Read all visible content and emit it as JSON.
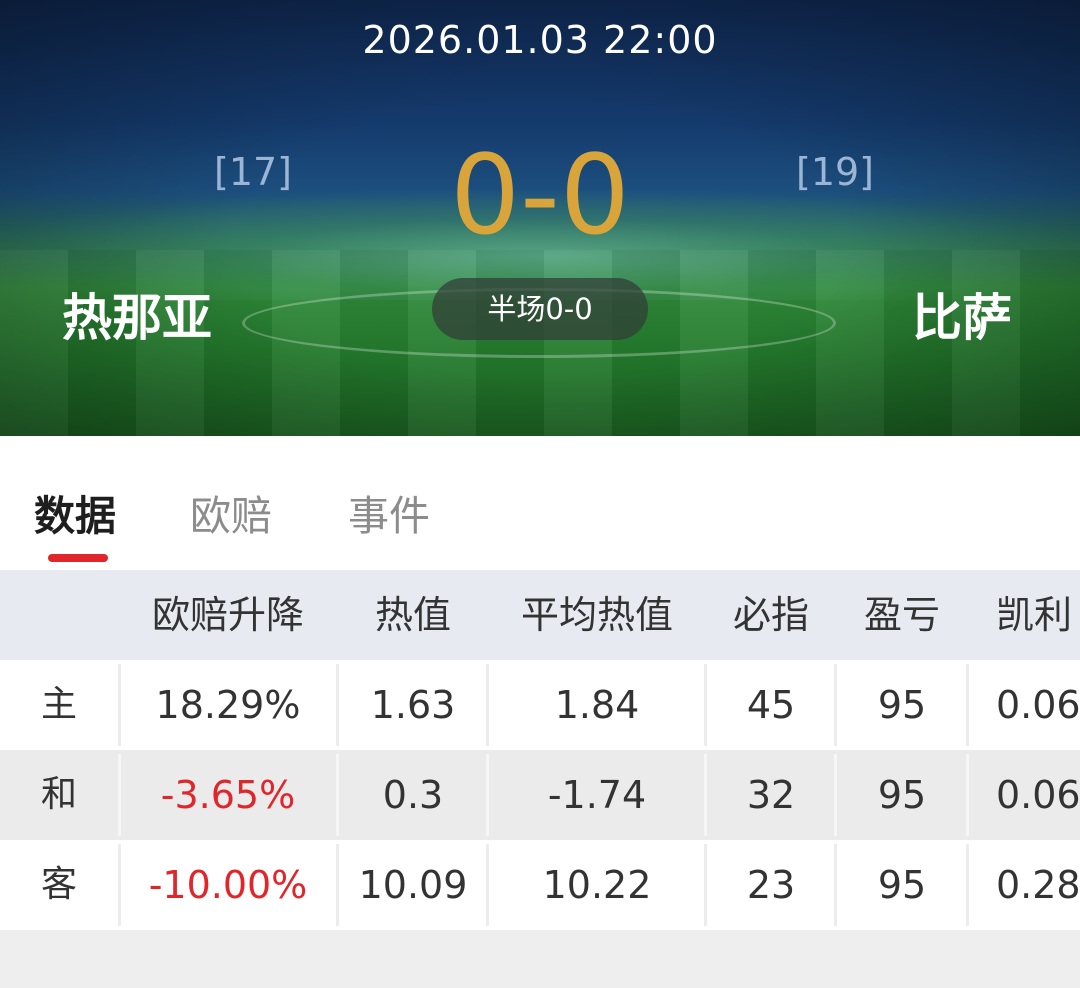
{
  "match": {
    "datetime": "2026.01.03 22:00",
    "home_rank": "[17]",
    "away_rank": "[19]",
    "score": "0-0",
    "home_team": "热那亚",
    "away_team": "比萨",
    "halftime": "半场0-0"
  },
  "tabs": [
    {
      "label": "数据",
      "active": true
    },
    {
      "label": "欧赔",
      "active": false
    },
    {
      "label": "事件",
      "active": false
    }
  ],
  "table": {
    "headers": [
      "",
      "欧赔升降",
      "热值",
      "平均热值",
      "必指",
      "盈亏",
      "凯利"
    ],
    "rows": [
      {
        "label": "主",
        "cells": [
          "18.29%",
          "1.63",
          "1.84",
          "45",
          "95",
          "0.06"
        ]
      },
      {
        "label": "和",
        "cells": [
          "-3.65%",
          "0.3",
          "-1.74",
          "32",
          "95",
          "0.06"
        ]
      },
      {
        "label": "客",
        "cells": [
          "-10.00%",
          "10.09",
          "10.22",
          "23",
          "95",
          "0.28"
        ]
      }
    ]
  },
  "colors": {
    "accent": "#e0262b",
    "score": "#d9a53a",
    "negative": "#e0262b"
  }
}
